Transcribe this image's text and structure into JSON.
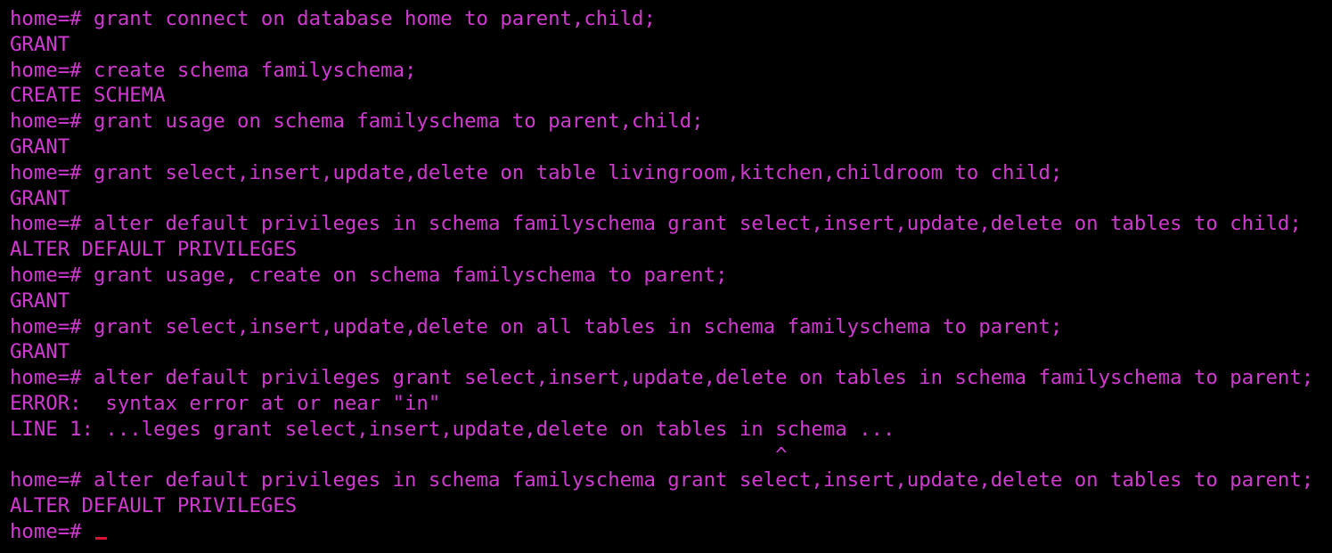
{
  "colors": {
    "background": "#000000",
    "text": "#d03ad0",
    "cursor": "#e01030"
  },
  "terminal": {
    "lines": [
      "home=# grant connect on database home to parent,child;",
      "GRANT",
      "home=# create schema familyschema;",
      "CREATE SCHEMA",
      "home=# grant usage on schema familyschema to parent,child;",
      "GRANT",
      "home=# grant select,insert,update,delete on table livingroom,kitchen,childroom to child;",
      "GRANT",
      "home=# alter default privileges in schema familyschema grant select,insert,update,delete on tables to child;",
      "ALTER DEFAULT PRIVILEGES",
      "home=# grant usage, create on schema familyschema to parent;",
      "GRANT",
      "home=# grant select,insert,update,delete on all tables in schema familyschema to parent;",
      "GRANT",
      "home=# alter default privileges grant select,insert,update,delete on tables in schema familyschema to parent;",
      "ERROR:  syntax error at or near \"in\"",
      "LINE 1: ...leges grant select,insert,update,delete on tables in schema ...",
      "                                                                ^",
      "home=# alter default privileges in schema familyschema grant select,insert,update,delete on tables to parent;",
      "ALTER DEFAULT PRIVILEGES"
    ],
    "prompt": "home=# "
  }
}
